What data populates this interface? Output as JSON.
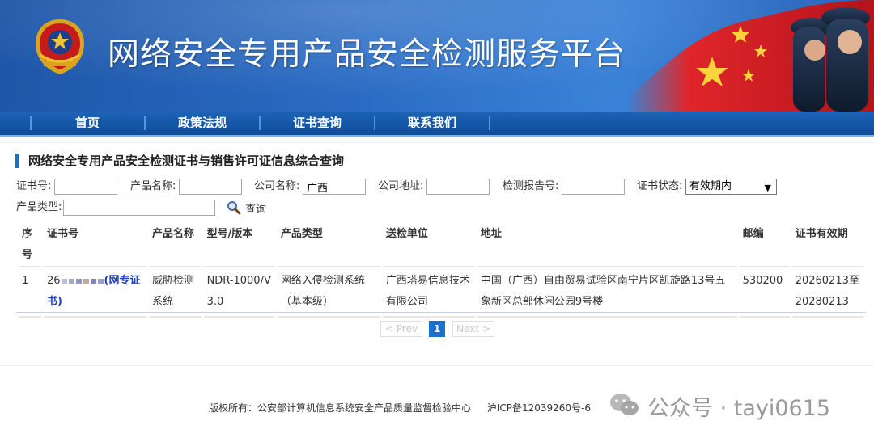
{
  "header": {
    "site_title": "网络安全专用产品安全检测服务平台"
  },
  "nav": {
    "items": [
      {
        "label": "首页"
      },
      {
        "label": "政策法规"
      },
      {
        "label": "证书查询"
      },
      {
        "label": "联系我们"
      }
    ]
  },
  "section": {
    "title": "网络安全专用产品安全检测证书与销售许可证信息综合查询"
  },
  "form": {
    "cert_no_label": "证书号:",
    "cert_no_value": "",
    "product_name_label": "产品名称:",
    "product_name_value": "",
    "company_name_label": "公司名称:",
    "company_name_value": "广西",
    "company_addr_label": "公司地址:",
    "company_addr_value": "",
    "report_no_label": "检测报告号:",
    "report_no_value": "",
    "cert_status_label": "证书状态:",
    "cert_status_value": "有效期内",
    "product_type_label": "产品类型:",
    "product_type_value": "",
    "search_label": "查询"
  },
  "table": {
    "headers": [
      "序号",
      "证书号",
      "产品名称",
      "型号/版本",
      "产品类型",
      "送检单位",
      "地址",
      "邮编",
      "证书有效期"
    ],
    "rows": [
      {
        "index": "1",
        "cert_prefix": "26",
        "cert_suffix": "(网专证书)",
        "product_name": "威胁检测系统",
        "model": "NDR-1000/V3.0",
        "product_type": "网络入侵检测系统（基本级）",
        "unit": "广西塔易信息技术有限公司",
        "address": "中国（广西）自由贸易试验区南宁片区凯旋路13号五象新区总部休闲公园9号楼",
        "zip": "530200",
        "validity": "20260213至20280213"
      }
    ]
  },
  "pagination": {
    "prev": "< Prev",
    "current": "1",
    "next": "Next >"
  },
  "footer": {
    "copyright": "版权所有：公安部计算机信息系统安全产品质量监督检验中心",
    "icp": "沪ICP备12039260号-6"
  },
  "watermark": {
    "text": "公众号 · tayi0615"
  },
  "colors": {
    "accent": "#1b6fcf",
    "nav_bg": "#0d4c9a",
    "link": "#1f3fbf"
  }
}
